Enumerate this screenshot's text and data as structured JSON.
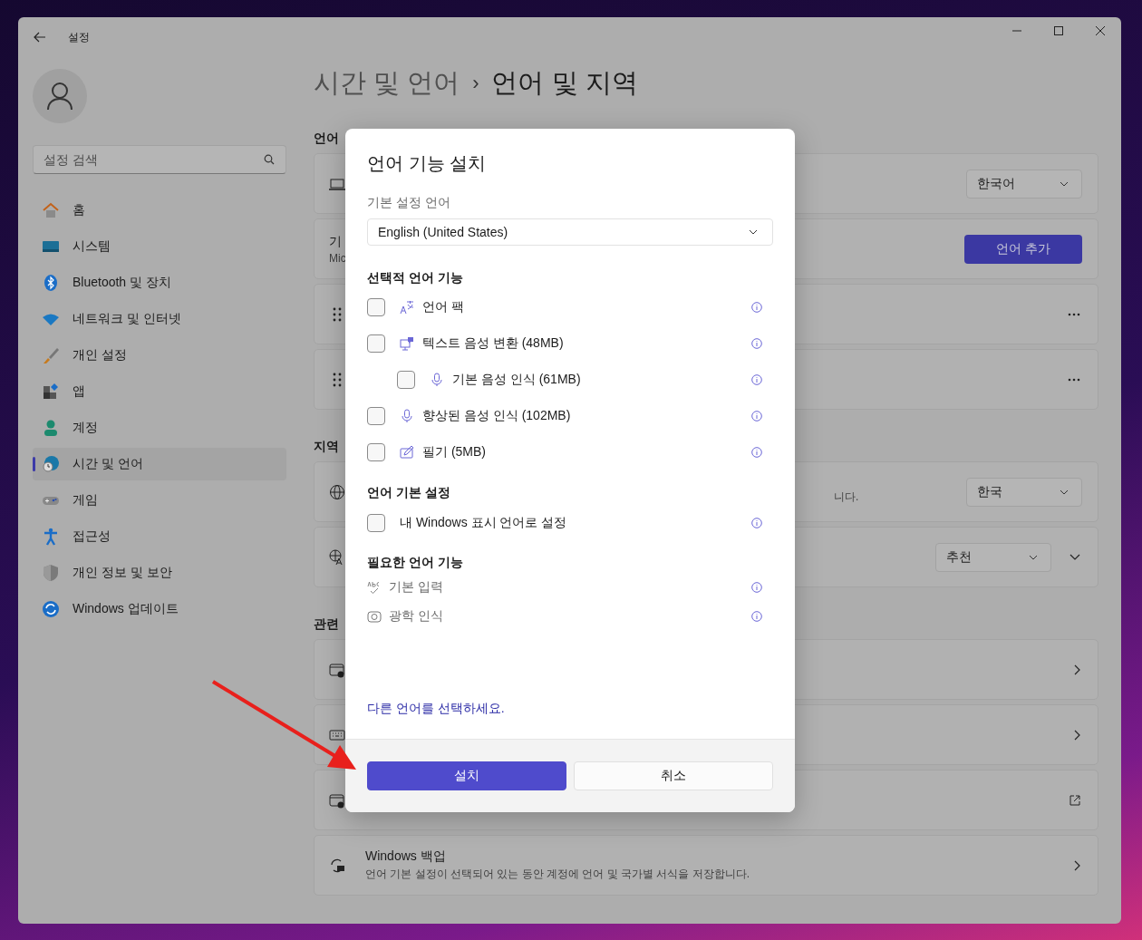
{
  "window": {
    "title": "설정"
  },
  "sidebar": {
    "search": {
      "placeholder": "설정 검색"
    },
    "items": [
      {
        "label": "홈",
        "selected": false
      },
      {
        "label": "시스템",
        "selected": false
      },
      {
        "label": "Bluetooth 및 장치",
        "selected": false
      },
      {
        "label": "네트워크 및 인터넷",
        "selected": false
      },
      {
        "label": "개인 설정",
        "selected": false
      },
      {
        "label": "앱",
        "selected": false
      },
      {
        "label": "계정",
        "selected": false
      },
      {
        "label": "시간 및 언어",
        "selected": true
      },
      {
        "label": "게임",
        "selected": false
      },
      {
        "label": "접근성",
        "selected": false
      },
      {
        "label": "개인 정보 및 보안",
        "selected": false
      },
      {
        "label": "Windows 업데이트",
        "selected": false
      }
    ]
  },
  "breadcrumb": {
    "parent": "시간 및 언어",
    "separator": "›",
    "current": "언어 및 지역"
  },
  "sections": [
    {
      "heading": "언어",
      "cards": [
        {
          "kind": "plain",
          "dropdown": "한국어"
        },
        {
          "kind": "plain",
          "title": "기",
          "subtitle": "Mic",
          "button": "언어 추가"
        },
        {
          "kind": "more"
        },
        {
          "kind": "more"
        }
      ]
    },
    {
      "heading": "지역",
      "cards": [
        {
          "kind": "plain",
          "tail_text": "니다.",
          "dropdown": "한국"
        },
        {
          "kind": "expand",
          "dropdown": "추천"
        }
      ]
    },
    {
      "heading": "관련",
      "cards": [
        {
          "kind": "chevron"
        },
        {
          "kind": "chevron"
        },
        {
          "kind": "external"
        },
        {
          "kind": "chevron",
          "title": "Windows 백업",
          "subtitle": "언어 기본 설정이 선택되어 있는 동안 계정에 언어 및 국가별 서식을 저장합니다."
        }
      ]
    }
  ],
  "dialog": {
    "title": "언어 기능 설치",
    "preferred_label": "기본 설정 언어",
    "preferred_value": "English (United States)",
    "sections": [
      {
        "heading": "선택적 언어 기능",
        "items": [
          {
            "kind": "checkbox",
            "label": "언어 팩",
            "checked": false
          },
          {
            "kind": "checkbox",
            "label": "텍스트 음성 변환 (48MB)",
            "checked": false,
            "children": [
              {
                "kind": "checkbox",
                "label": "기본 음성 인식 (61MB)",
                "checked": false
              }
            ]
          },
          {
            "kind": "checkbox",
            "label": "향상된 음성 인식 (102MB)",
            "checked": false
          },
          {
            "kind": "checkbox",
            "label": "필기 (5MB)",
            "checked": false
          }
        ]
      },
      {
        "heading": "언어 기본 설정",
        "items": [
          {
            "kind": "checkbox",
            "label": "내 Windows 표시 언어로 설정",
            "checked": false
          }
        ]
      },
      {
        "heading": "필요한 언어 기능",
        "items": [
          {
            "kind": "plain",
            "label": "기본 입력"
          },
          {
            "kind": "plain",
            "label": "광학 인식"
          }
        ]
      }
    ],
    "link": "다른 언어를 선택하세요.",
    "buttons": [
      {
        "label": "설치",
        "primary": true
      },
      {
        "label": "취소",
        "primary": false
      }
    ]
  }
}
